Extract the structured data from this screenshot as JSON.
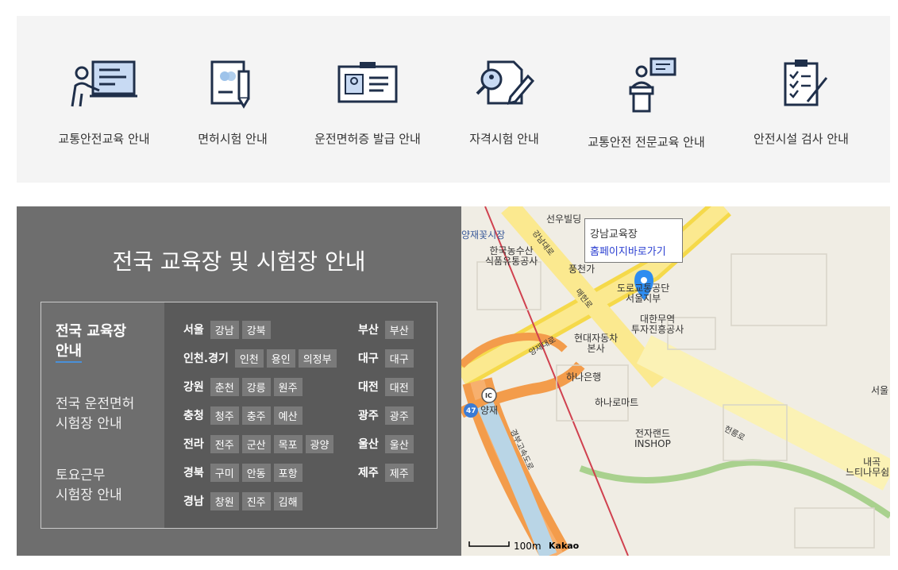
{
  "quick_links": [
    {
      "icon": "teacher-board-icon",
      "label": "교통안전교육 안내"
    },
    {
      "icon": "license-test-icon",
      "label": "면허시험 안내"
    },
    {
      "icon": "id-card-icon",
      "label": "운전면허증 발급 안내"
    },
    {
      "icon": "certificate-exam-icon",
      "label": "자격시험 안내"
    },
    {
      "icon": "speaker-podium-icon",
      "label": "교통안전 전문교육 안내"
    },
    {
      "icon": "checklist-icon",
      "label": "안전시설 검사 안내"
    }
  ],
  "guide": {
    "title": "전국 교육장 및 시험장 안내",
    "tabs": [
      {
        "line1": "전국 교육장",
        "line2": "안내",
        "active": true
      },
      {
        "line1": "전국 운전면허",
        "line2": "시험장 안내",
        "active": false
      },
      {
        "line1": "토요근무",
        "line2": "시험장 안내",
        "active": false
      }
    ],
    "left_regions": [
      {
        "region": "서울",
        "places": [
          "강남",
          "강북"
        ]
      },
      {
        "region": "인천.경기",
        "places": [
          "인천",
          "용인",
          "의정부"
        ]
      },
      {
        "region": "강원",
        "places": [
          "춘천",
          "강릉",
          "원주"
        ]
      },
      {
        "region": "충청",
        "places": [
          "청주",
          "충주",
          "예산"
        ]
      },
      {
        "region": "전라",
        "places": [
          "전주",
          "군산",
          "목포",
          "광양"
        ]
      },
      {
        "region": "경북",
        "places": [
          "구미",
          "안동",
          "포항"
        ]
      },
      {
        "region": "경남",
        "places": [
          "창원",
          "진주",
          "김해"
        ]
      }
    ],
    "right_regions": [
      {
        "region": "부산",
        "places": [
          "부산"
        ]
      },
      {
        "region": "대구",
        "places": [
          "대구"
        ]
      },
      {
        "region": "대전",
        "places": [
          "대전"
        ]
      },
      {
        "region": "광주",
        "places": [
          "광주"
        ]
      },
      {
        "region": "울산",
        "places": [
          "울산"
        ]
      },
      {
        "region": "제주",
        "places": [
          "제주"
        ]
      }
    ]
  },
  "map": {
    "popup_title": "강남교육장",
    "popup_link": "홈페이지바로가기",
    "labels": {
      "seonwoo": "선우빌딩",
      "flower_market": "양재꽃시장",
      "agro_1": "한국농수산",
      "agro_2": "식품유통공사",
      "pungcheon": "풍천가",
      "road_auth_1": "도로교통공단",
      "road_auth_2": "서울지부",
      "kotra_1": "대한무역",
      "kotra_2": "투자진흥공사",
      "hyundai_1": "현대자동차",
      "hyundai_2": "본사",
      "hana_bank": "하나은행",
      "hanaro": "하나로마트",
      "inshop_1": "전자랜드",
      "inshop_2": "INSHOP",
      "yangjae": "양재",
      "ic": "IC",
      "route_num": "47",
      "seoul_edge": "서울",
      "naegok_1": "내곡",
      "naegok_2": "느티나무쉼터",
      "highway": "경부고속도로",
      "road_yangjae": "양재대로",
      "road_hunreung": "헌릉로",
      "road_maeheon": "매헌로",
      "road_gangnam": "강남대로"
    },
    "scale": "100m",
    "brand": "Kakao"
  }
}
